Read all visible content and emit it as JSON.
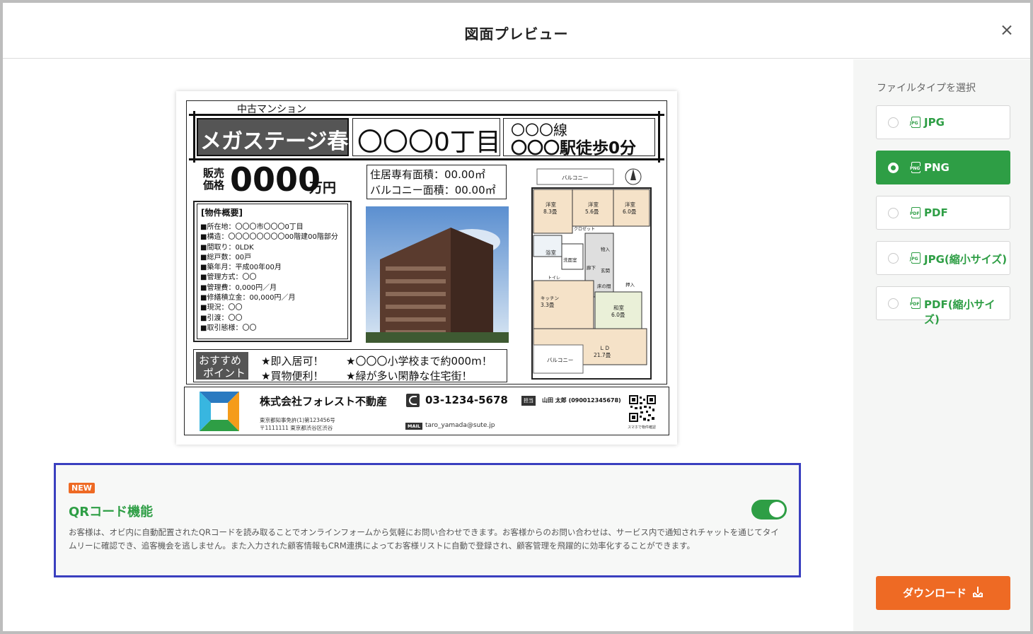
{
  "modal": {
    "title": "図面プレビュー"
  },
  "flyer": {
    "category": "中古マンション",
    "name": "メガステージ春日",
    "address_short": "〇〇〇0丁目",
    "station_line1": "〇〇〇線",
    "station_line2": "〇〇〇駅徒歩0分",
    "price_label_1": "販売",
    "price_label_2": "価格",
    "price_value": "0000",
    "price_unit": "万円",
    "area_line1": "住居専有面積：00.00㎡",
    "area_line2": "バルコニー面積：00.00㎡",
    "summary_title": "[物件概要]",
    "summary_items": [
      "■所在地：〇〇〇市〇〇〇0丁目",
      "■構造：〇〇〇〇〇〇〇〇00階建00階部分",
      "■間取り：0LDK",
      "■総戸数：00戸",
      "■築年月：平成00年00月",
      "■管理方式：〇〇",
      "■管理費：0,000円／月",
      "■修繕積立金：00,000円／月",
      "■現況：〇〇",
      "■引渡：〇〇",
      "■取引態様：〇〇"
    ],
    "recommend_label_1": "おすすめ",
    "recommend_label_2": "ポイント",
    "points": [
      "★即入居可！",
      "★〇〇〇小学校まで約000m！",
      "★買物便利！",
      "★緑が多い閑静な住宅街！"
    ],
    "floorplan": {
      "balcony_top": "バルコニー",
      "room1": "洋室",
      "room1_size": "8.3畳",
      "room2": "洋室",
      "room2_size": "5.6畳",
      "room3": "洋室",
      "room3_size": "6.0畳",
      "closet": "クロゼット",
      "bath": "浴室",
      "washroom": "洗面室",
      "storage": "物入",
      "hall": "廊下",
      "entrance": "玄関",
      "toilet": "トイレ",
      "tokonoma": "床の間",
      "oshiire": "押入",
      "kitchen": "キッチン",
      "kitchen_size": "3.3畳",
      "washitsu": "和室",
      "washitsu_size": "6.0畳",
      "ld": "ＬＤ",
      "ld_size": "21.7畳",
      "balcony_bottom": "バルコニー"
    },
    "company": "株式会社フォレスト不動産",
    "license": "東京都知事免許(1)第123456号",
    "company_address": "〒1111111 東京都渋谷区渋谷",
    "phone": "03-1234-5678",
    "staff_badge": "担当",
    "staff": "山田 太郎 (090012345678)",
    "mail_badge": "MAIL",
    "email": "taro_yamada@sute.jp",
    "qr_caption": "スマホで物件確認"
  },
  "qr_feature": {
    "badge": "NEW",
    "title": "QRコード機能",
    "enabled": true,
    "description": "お客様は、オビ内に自動配置されたQRコードを読み取ることでオンラインフォームから気軽にお問い合わせできます。お客様からのお問い合わせは、サービス内で通知されチャットを通じてタイムリーに確認でき、追客機会を逃しません。また入力された顧客情報もCRM連携によってお客様リストに自動で登録され、顧客管理を飛躍的に効率化することができます。"
  },
  "sidebar": {
    "label": "ファイルタイプを選択",
    "options": [
      {
        "label": "JPG",
        "icon": "JPG",
        "selected": false
      },
      {
        "label": "PNG",
        "icon": "PNG",
        "selected": true
      },
      {
        "label": "PDF",
        "icon": "PDF",
        "selected": false
      },
      {
        "label": "JPG(縮小サイズ)",
        "icon": "JPG",
        "selected": false
      },
      {
        "label": "PDF(縮小サイズ)",
        "icon": "PDF",
        "selected": false
      }
    ],
    "download_label": "ダウンロード"
  },
  "colors": {
    "green": "#2e9e45",
    "orange": "#ee6a24",
    "highlight": "#3a3fbf"
  }
}
